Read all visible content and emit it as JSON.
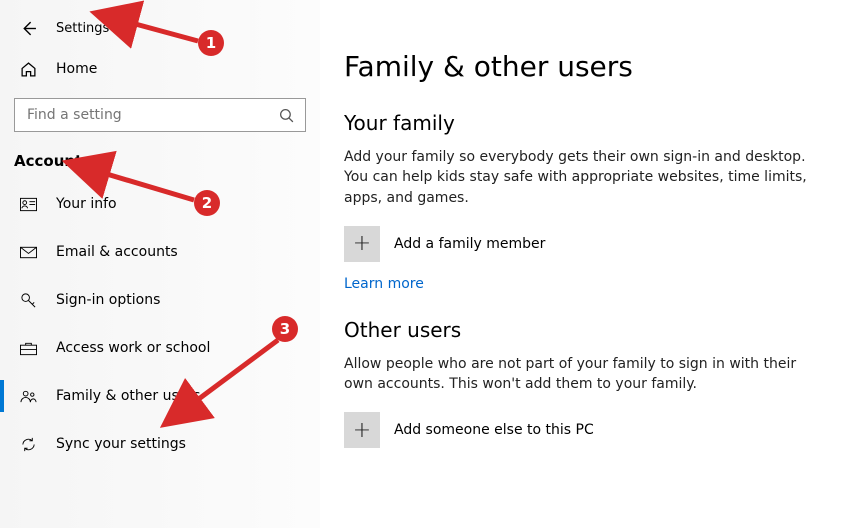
{
  "header": {
    "app_title": "Settings"
  },
  "search": {
    "placeholder": "Find a setting"
  },
  "sidebar": {
    "home": "Home",
    "section": "Accounts",
    "items": [
      {
        "label": "Your info"
      },
      {
        "label": "Email & accounts"
      },
      {
        "label": "Sign-in options"
      },
      {
        "label": "Access work or school"
      },
      {
        "label": "Family & other users"
      },
      {
        "label": "Sync your settings"
      }
    ]
  },
  "main": {
    "title": "Family & other users",
    "family": {
      "heading": "Your family",
      "desc": "Add your family so everybody gets their own sign-in and desktop. You can help kids stay safe with appropriate websites, time limits, apps, and games.",
      "add": "Add a family member",
      "learn": "Learn more"
    },
    "other": {
      "heading": "Other users",
      "desc": "Allow people who are not part of your family to sign in with their own accounts. This won't add them to your family.",
      "add": "Add someone else to this PC"
    }
  },
  "annotations": {
    "1": "1",
    "2": "2",
    "3": "3"
  }
}
